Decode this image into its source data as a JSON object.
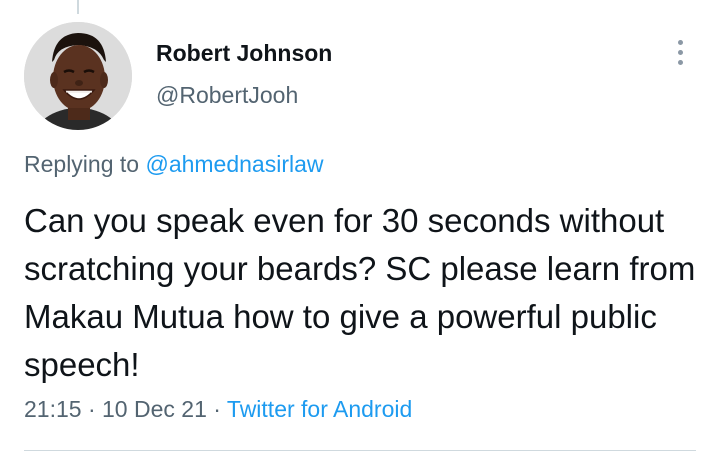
{
  "tweet": {
    "author": {
      "display_name": "Robert Johnson",
      "handle": "@RobertJooh",
      "avatar_icon": "profile-photo"
    },
    "more_icon": "vertical-ellipsis-icon",
    "replying_prefix": "Replying to",
    "replying_to": "@ahmednasirlaw",
    "text": "Can you speak even for 30 seconds without scratching your beards? SC please learn from Makau Mutua how to give a powerful public speech!",
    "time": "21:15",
    "separator": "·",
    "date": "10 Dec 21",
    "source": "Twitter for Android"
  },
  "colors": {
    "primary_text": "#0f1419",
    "secondary_text": "#536471",
    "link": "#1d9bf0",
    "divider": "#cfd9de"
  }
}
